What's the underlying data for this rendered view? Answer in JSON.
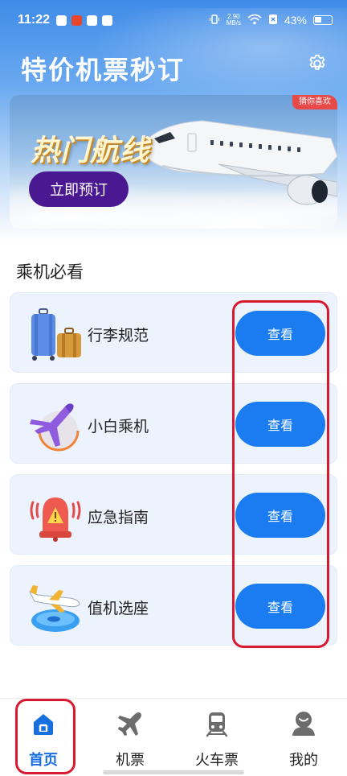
{
  "status_bar": {
    "time": "11:22",
    "net_speed_value": "2.90",
    "net_speed_unit": "MB/s",
    "battery": "43%"
  },
  "header": {
    "title": "特价机票秒订"
  },
  "banner": {
    "tag": "猜你喜欢",
    "heading": "热门航线",
    "button_label": "立即预订"
  },
  "section": {
    "title": "乘机必看",
    "items": [
      {
        "label": "行李规范",
        "button": "查看",
        "icon": "luggage-icon"
      },
      {
        "label": "小白乘机",
        "button": "查看",
        "icon": "airplane-globe-icon"
      },
      {
        "label": "应急指南",
        "button": "查看",
        "icon": "alarm-bell-icon"
      },
      {
        "label": "值机选座",
        "button": "查看",
        "icon": "plane-takeoff-icon"
      }
    ]
  },
  "bottom_nav": {
    "items": [
      {
        "label": "首页",
        "icon": "home-icon",
        "active": true
      },
      {
        "label": "机票",
        "icon": "plane-icon",
        "active": false
      },
      {
        "label": "火车票",
        "icon": "train-icon",
        "active": false
      },
      {
        "label": "我的",
        "icon": "user-icon",
        "active": false
      }
    ]
  },
  "colors": {
    "primary": "#1a7cf0",
    "banner_button": "#4a1890",
    "highlight": "#d8192f",
    "active_nav": "#1a6fe0"
  }
}
